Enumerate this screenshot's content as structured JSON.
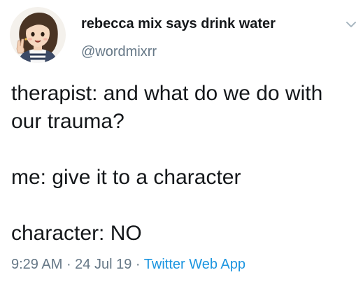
{
  "tweet": {
    "author": {
      "display_name": "rebecca mix says drink water",
      "handle": "@wordmixrr"
    },
    "caret_icon": "chevron-down-icon",
    "lines": [
      "therapist: and what do we do with",
      "our trauma?",
      "me: give it to a character",
      "character: NO"
    ],
    "meta": {
      "time": "9:29 AM",
      "separator": " · ",
      "date": "24 Jul 19",
      "source": "Twitter Web App"
    }
  },
  "colors": {
    "text": "#14171a",
    "secondary": "#657786",
    "link": "#1b95e0",
    "background": "#ffffff"
  }
}
